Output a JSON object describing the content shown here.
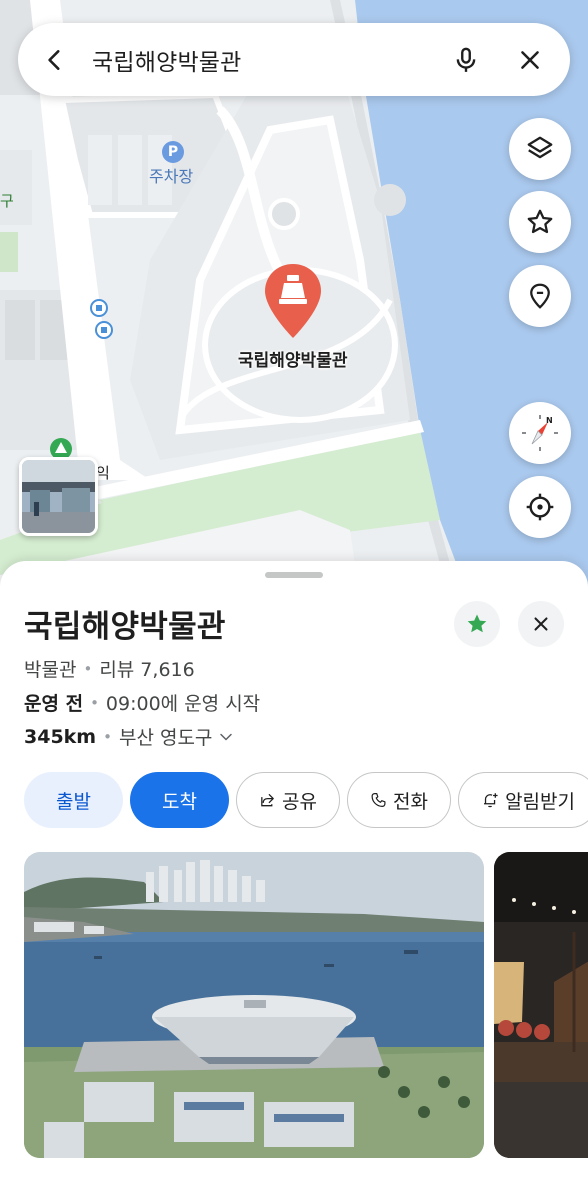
{
  "search": {
    "query": "국립해양박물관"
  },
  "map": {
    "place_marker_label": "국립해양박물관",
    "parking_label": "주차장",
    "parking_letter": "P",
    "side_label_left": "구",
    "side_label_small": "익",
    "colors": {
      "water": "#aac9ee",
      "land": "#eceff1",
      "park": "#d4ecd0",
      "road": "#ffffff",
      "marker": "#e8604c"
    }
  },
  "place": {
    "title": "국립해양박물관",
    "category": "박물관",
    "reviews_label": "리뷰 7,616",
    "status": "운영 전",
    "hours_text": "09:00에 운영 시작",
    "distance": "345km",
    "address": "부산 영도구",
    "saved": true
  },
  "actions": {
    "start_label": "출발",
    "arrive_label": "도착",
    "share_label": "공유",
    "call_label": "전화",
    "notify_label": "알림받기"
  },
  "icons": [
    "back-arrow-icon",
    "mic-icon",
    "close-icon",
    "layers-icon",
    "star-icon",
    "pin-icon",
    "compass-icon",
    "locate-icon",
    "museum-icon",
    "share-icon",
    "phone-icon",
    "bell-plus-icon",
    "chevron-down-icon"
  ],
  "accent_color": "#1a73e8"
}
